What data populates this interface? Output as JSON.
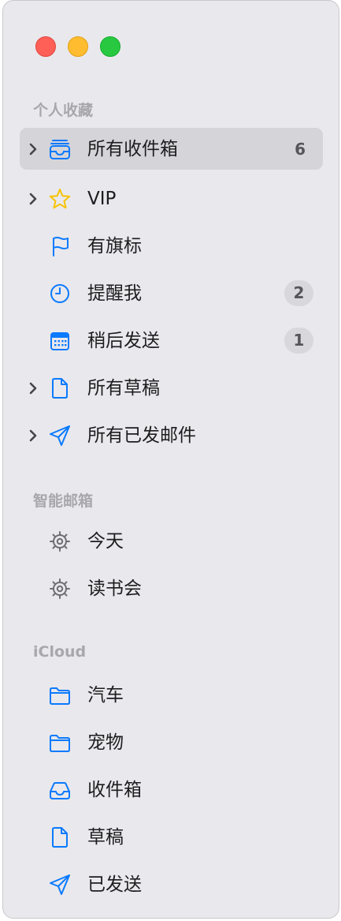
{
  "colors": {
    "accent": "#0a7aff",
    "star": "#f7c300",
    "sidebar_bg": "#e9e8ec",
    "selection": "#d5d4d9"
  },
  "window_controls": [
    "close",
    "minimize",
    "maximize"
  ],
  "sections": {
    "favorites": {
      "title": "个人收藏",
      "items": [
        {
          "label": "所有收件箱",
          "icon": "tray-stack-icon",
          "count": "6",
          "selected": true,
          "expandable": true
        },
        {
          "label": "VIP",
          "icon": "star-icon",
          "expandable": true
        },
        {
          "label": "有旗标",
          "icon": "flag-icon"
        },
        {
          "label": "提醒我",
          "icon": "clock-icon",
          "count": "2"
        },
        {
          "label": "稍后发送",
          "icon": "calendar-icon",
          "count": "1"
        },
        {
          "label": "所有草稿",
          "icon": "document-icon",
          "expandable": true
        },
        {
          "label": "所有已发邮件",
          "icon": "paper-plane-icon",
          "expandable": true
        }
      ]
    },
    "smart_mailboxes": {
      "title": "智能邮箱",
      "items": [
        {
          "label": "今天",
          "icon": "gear-icon"
        },
        {
          "label": "读书会",
          "icon": "gear-icon"
        }
      ]
    },
    "icloud": {
      "title": "iCloud",
      "items": [
        {
          "label": "汽车",
          "icon": "folder-icon"
        },
        {
          "label": "宠物",
          "icon": "folder-icon"
        },
        {
          "label": "收件箱",
          "icon": "tray-icon"
        },
        {
          "label": "草稿",
          "icon": "document-icon"
        },
        {
          "label": "已发送",
          "icon": "paper-plane-icon"
        }
      ]
    }
  }
}
